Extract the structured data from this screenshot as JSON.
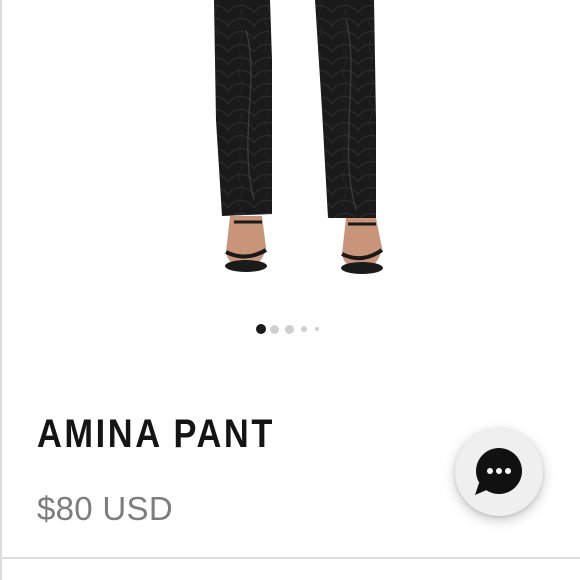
{
  "product": {
    "title": "AMINA PANT",
    "price": "$80 USD",
    "image_icon": "product-photo"
  },
  "carousel": {
    "total_slides": 5,
    "active_index": 0,
    "active_color": "#1a1a1a",
    "inactive_color": "#cfcfcf"
  },
  "chat": {
    "icon": "chat-bubble-ellipsis-icon",
    "fab_color": "#efefef",
    "bubble_color": "#111111"
  },
  "colors": {
    "title": "#141414",
    "price": "#7d7d7d",
    "background": "#ffffff"
  }
}
